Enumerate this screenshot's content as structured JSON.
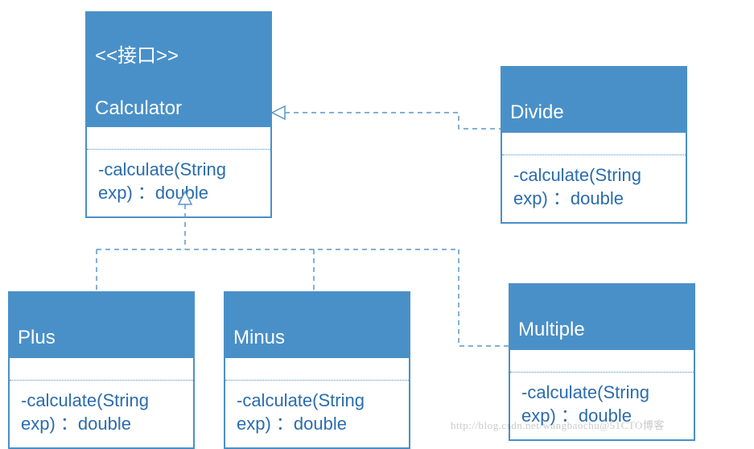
{
  "calculator": {
    "stereotype": "<<接口>>",
    "name": "Calculator",
    "method": "-calculate(String\nexp) ：double"
  },
  "divide": {
    "name": "Divide",
    "method": "-calculate(String\nexp) ：double"
  },
  "plus": {
    "name": "Plus",
    "method": "-calculate(String\nexp) ：double"
  },
  "minus": {
    "name": "Minus",
    "method": "-calculate(String\nexp) ：double"
  },
  "multiple": {
    "name": "Multiple",
    "method": "-calculate(String\nexp) ：double"
  },
  "watermark": "http://blog.csdn.net/wangbaochu@51CTO博客",
  "chart_data": {
    "type": "uml-class-diagram",
    "classes": [
      {
        "id": "Calculator",
        "stereotype": "接口",
        "is_interface": true,
        "methods": [
          "-calculate(String exp) : double"
        ]
      },
      {
        "id": "Divide",
        "methods": [
          "-calculate(String exp) : double"
        ]
      },
      {
        "id": "Plus",
        "methods": [
          "-calculate(String exp) : double"
        ]
      },
      {
        "id": "Minus",
        "methods": [
          "-calculate(String exp) : double"
        ]
      },
      {
        "id": "Multiple",
        "methods": [
          "-calculate(String exp) : double"
        ]
      }
    ],
    "relations": [
      {
        "from": "Divide",
        "to": "Calculator",
        "type": "realization"
      },
      {
        "from": "Plus",
        "to": "Calculator",
        "type": "realization"
      },
      {
        "from": "Minus",
        "to": "Calculator",
        "type": "realization"
      },
      {
        "from": "Multiple",
        "to": "Calculator",
        "type": "realization"
      }
    ]
  }
}
